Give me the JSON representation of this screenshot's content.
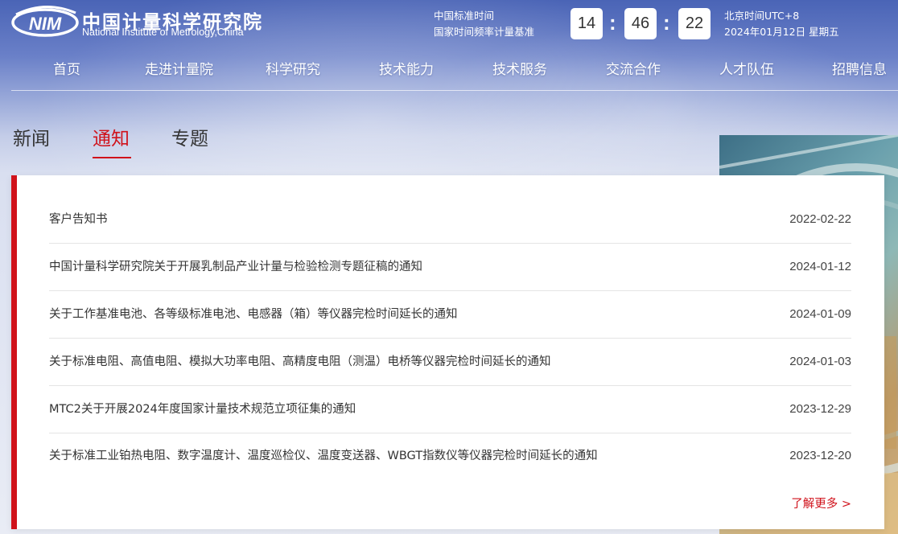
{
  "header": {
    "logo_cn": "中国计量科学研究院",
    "logo_en": "National Institute of Metrology,China",
    "time_label_1": "中国标准时间",
    "time_label_2": "国家时间频率计量基准",
    "clock": {
      "hours": "14",
      "minutes": "46",
      "seconds": "22",
      "separator": ":"
    },
    "beijing_label": "北京时间UTC+8",
    "date_label": "2024年01月12日 星期五"
  },
  "nav": [
    "首页",
    "走进计量院",
    "科学研究",
    "技术能力",
    "技术服务",
    "交流合作",
    "人才队伍",
    "招聘信息"
  ],
  "tabs": [
    {
      "label": "新闻",
      "active": false
    },
    {
      "label": "通知",
      "active": true
    },
    {
      "label": "专题",
      "active": false
    }
  ],
  "notices": [
    {
      "title": "客户告知书",
      "date": "2022-02-22"
    },
    {
      "title": "中国计量科学研究院关于开展乳制品产业计量与检验检测专题征稿的通知",
      "date": "2024-01-12"
    },
    {
      "title": "关于工作基准电池、各等级标准电池、电感器（箱）等仪器完检时间延长的通知",
      "date": "2024-01-09"
    },
    {
      "title": "关于标准电阻、高值电阻、模拟大功率电阻、高精度电阻（测温）电桥等仪器完检时间延长的通知",
      "date": "2024-01-03"
    },
    {
      "title": "MTC2关于开展2024年度国家计量技术规范立项征集的通知",
      "date": "2023-12-29"
    },
    {
      "title": "关于标准工业铂热电阻、数字温度计、温度巡检仪、温度变送器、WBGT指数仪等仪器完检时间延长的通知",
      "date": "2023-12-20"
    }
  ],
  "more_label": "了解更多 >",
  "colors": {
    "accent": "#d0121b",
    "header_blue": "#4a64b6"
  }
}
